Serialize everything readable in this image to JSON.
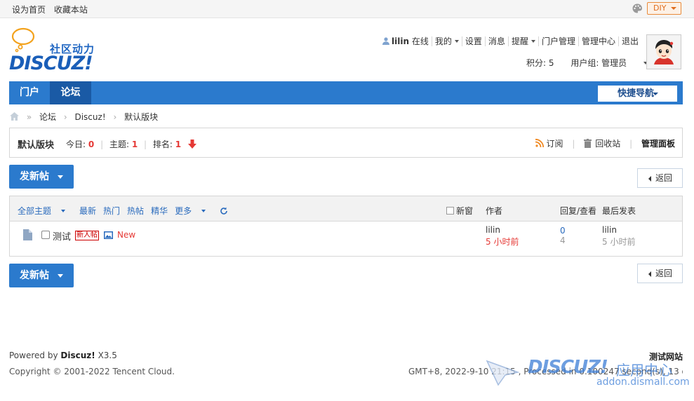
{
  "topbar": {
    "links": [
      "设为首页",
      "收藏本站"
    ],
    "diy_label": "DIY"
  },
  "logo": {
    "slogan": "社区动力",
    "wordmark": "DISCUZ!"
  },
  "usernav": {
    "username": "lilin",
    "status": "在线",
    "items": [
      "我的",
      "设置",
      "消息",
      "提醒",
      "门户管理",
      "管理中心",
      "退出"
    ],
    "points": "积分: 5",
    "usergroup": "用户组: 管理员"
  },
  "nav": {
    "tabs": [
      "门户",
      "论坛"
    ],
    "active_tab": "论坛",
    "quick_nav": "快捷导航"
  },
  "breadcrumb": [
    "论坛",
    "Discuz!",
    "默认版块"
  ],
  "forum": {
    "name": "默认版块",
    "today_label": "今日:",
    "today_value": "0",
    "topics_label": "主题:",
    "topics_value": "1",
    "rank_label": "排名:",
    "rank_value": "1",
    "subscribe": "订阅",
    "recycle": "回收站",
    "admin_panel": "管理面板"
  },
  "buttons": {
    "new_post": "发新帖",
    "back": "返回"
  },
  "thread_list": {
    "filters": [
      "全部主题",
      "最新",
      "热门",
      "热帖",
      "精华",
      "更多"
    ],
    "new_window": "新窗",
    "col_author": "作者",
    "col_replies": "回复/查看",
    "col_last": "最后发表",
    "rows": [
      {
        "title": "测试",
        "badge": "新人帖",
        "tag": "New",
        "author": "lilin",
        "author_time": "5 小时前",
        "replies": "0",
        "views": "4",
        "last_user": "lilin",
        "last_time": "5 小时前"
      }
    ]
  },
  "footer": {
    "powered_prefix": "Powered by",
    "powered_brand": "Discuz!",
    "powered_version": "X3.5",
    "copyright": "Copyright © 2001-2022 Tencent Cloud.",
    "site_name": "测试网站",
    "stats": "GMT+8, 2022-9-10 21:15 , Processed in 0.100247 second(s), 13 queries ."
  },
  "watermark": {
    "word": "DISCUZ!",
    "cn": "应用中心",
    "url": "addon.dismall.com"
  },
  "colors": {
    "primary": "#2b7acd",
    "primary_dark": "#1a5aa5",
    "accent_red": "#e53935",
    "diy_orange": "#e06c1c"
  }
}
